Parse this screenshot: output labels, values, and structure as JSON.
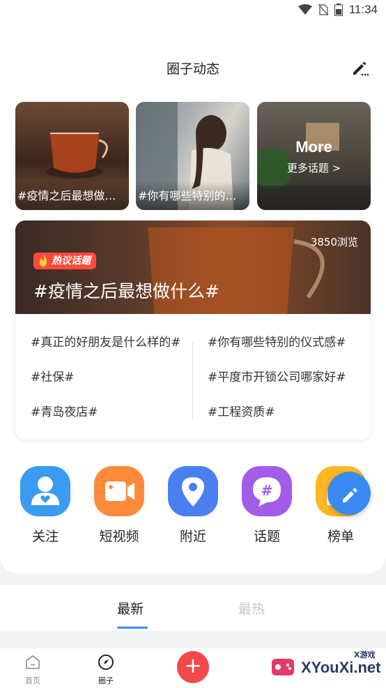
{
  "status_bar": {
    "time": "11:34"
  },
  "header": {
    "title": "圈子动态"
  },
  "topic_tiles": [
    {
      "caption": "#疫情之后最想做什么#"
    },
    {
      "caption": "#你有哪些特别的仪式感#"
    },
    {
      "more_title": "More",
      "more_sub": "更多话题 >"
    }
  ],
  "hot_topic": {
    "views": "3850浏览",
    "badge": "热议话题",
    "title": "#疫情之后最想做什么#",
    "topics": [
      "#真正的好朋友是什么样的#",
      "#你有哪些特别的仪式感#",
      "#社保#",
      "#平度市开锁公司哪家好#",
      "#青岛夜店#",
      "#工程资质#"
    ]
  },
  "shortcuts": [
    {
      "label": "关注",
      "icon": "user-heart-icon",
      "color": "#3a9bf0"
    },
    {
      "label": "短视频",
      "icon": "video-camera-icon",
      "color": "#ff8a3c"
    },
    {
      "label": "附近",
      "icon": "location-pin-icon",
      "color": "#4a7ff0"
    },
    {
      "label": "话题",
      "icon": "hashtag-chat-icon",
      "color": "#a25ce8"
    },
    {
      "label": "榜单",
      "icon": "ranking-icon",
      "color": "#ffb624"
    }
  ],
  "feed_tabs": {
    "latest": "最新",
    "hot": "最热"
  },
  "bottom_nav": {
    "home": "首页",
    "circle": "圈子",
    "add": "+"
  },
  "watermark": {
    "site": "XYouXi.net",
    "tag": "X游戏"
  }
}
